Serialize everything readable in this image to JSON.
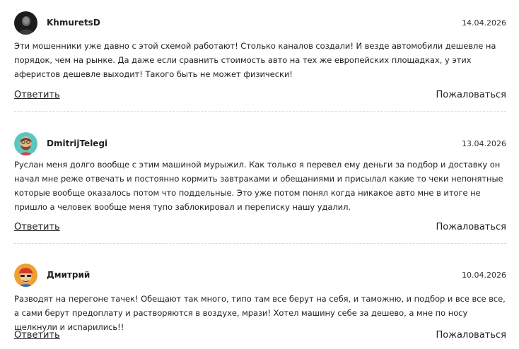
{
  "comments": [
    {
      "author": "KhmuretsD",
      "date": "14.04.2026",
      "avatar_icon": "dark-portrait-avatar",
      "text": "Эти мошенники уже давно с этой схемой работают! Столько каналов создали! И везде автомобили дешевле на порядок, чем на рынке. Да даже если сравнить стоимость авто на тех же европейских площадках, у этих аферистов дешевле выходит! Такого быть не может физически!",
      "reply_label": "Ответить",
      "report_label": "Пожаловаться"
    },
    {
      "author": "DmitrijTelegi",
      "date": "13.04.2026",
      "avatar_icon": "bearded-cartoon-avatar",
      "text": "Руслан меня долго вообще с этим машиной мурыжил. Как только я перевел ему деньги за подбор и доставку он начал мне реже отвечать и постоянно кормить завтраками и обещаниями и присылал какие то чеки непонятные которые вообще оказалось потом что поддельные. Это уже потом понял когда никакое авто мне в итоге не пришло а человек вообще меня тупо заблокировал и переписку нашу удалил.",
      "reply_label": "Ответить",
      "report_label": "Пожаловаться"
    },
    {
      "author": "Дмитрий",
      "date": "10.04.2026",
      "avatar_icon": "cartoon-cap-avatar",
      "text": "Разводят на перегоне тачек! Обещают так много, типо там все берут на себя, и таможню, и подбор и все все все, а сами берут предоплату и растворяются в воздухе, мрази! Хотел машину себе за дешево, а мне по носу щелкнули и испарились!!",
      "reply_label": "Ответить",
      "report_label": "Пожаловаться"
    }
  ]
}
